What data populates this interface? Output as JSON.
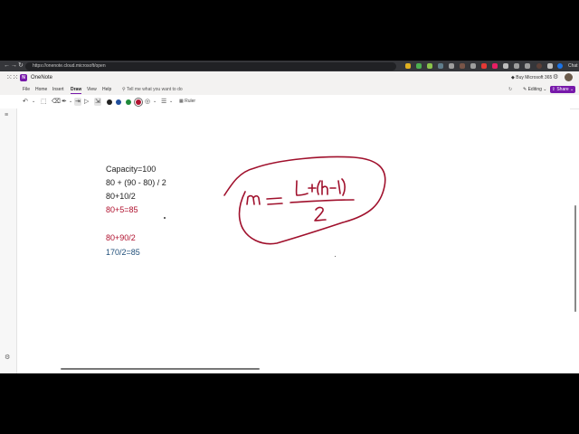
{
  "browser": {
    "url": "https://onenote.cloud.microsoft/open",
    "profile_label": "Chat"
  },
  "app": {
    "name": "OneNote",
    "logo_letter": "N",
    "buy_label": "Buy Microsoft 365",
    "editing_label": "Editing",
    "share_label": "Share"
  },
  "menu": {
    "items": [
      "File",
      "Home",
      "Insert",
      "Draw",
      "View",
      "Help"
    ],
    "active": "Draw",
    "tell_me": "Tell me what you want to do"
  },
  "toolbar": {
    "ruler_label": "Ruler",
    "pen_colors": [
      "#222222",
      "#1f4e9c",
      "#1e8a3a",
      "#b0122f"
    ]
  },
  "note": {
    "lines": [
      {
        "text": "Capacity=100",
        "color": "black"
      },
      {
        "text": "80 + (90 - 80) / 2",
        "color": "black"
      },
      {
        "text": "80+10/2",
        "color": "black"
      },
      {
        "text": "80+5=85",
        "color": "red"
      },
      {
        "text": "80+90/2",
        "color": "red"
      },
      {
        "text": "170/2=85",
        "color": "blue"
      }
    ],
    "ink_formula": "m = L+(h-1) / 2",
    "ink_color": "#a0102c"
  }
}
